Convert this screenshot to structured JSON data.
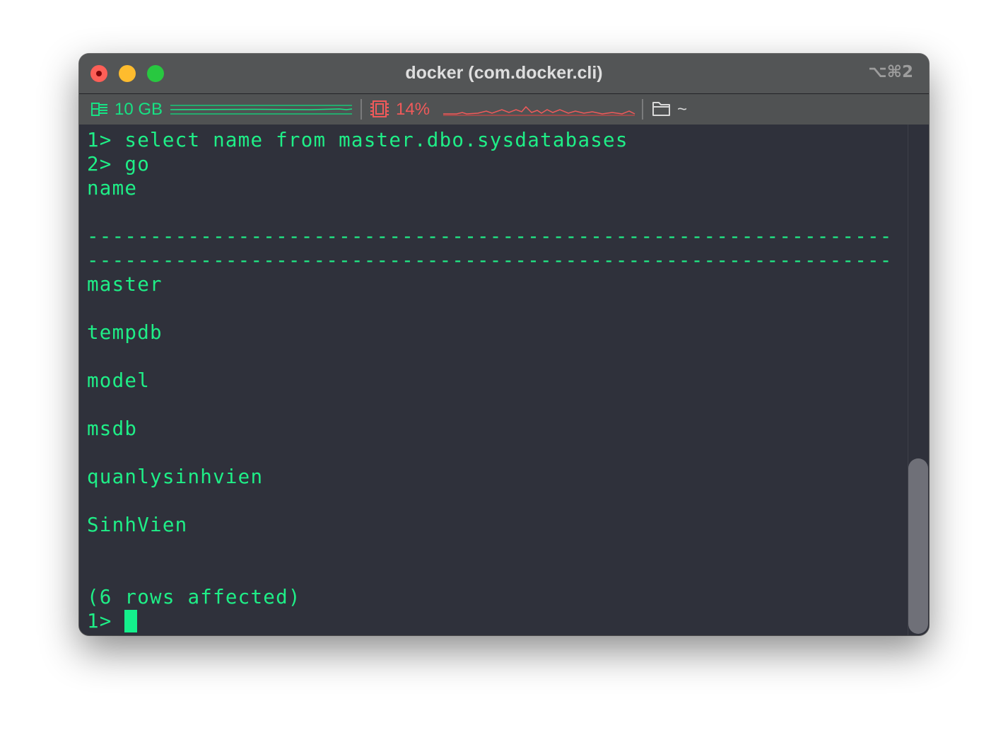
{
  "window": {
    "title": "docker (com.docker.cli)",
    "shortcut": "⌥⌘2"
  },
  "statusbar": {
    "memory": {
      "value": "10 GB",
      "color": "#17e284",
      "icon": "memory-icon"
    },
    "cpu": {
      "value": "14%",
      "color": "#f05a5a",
      "icon": "cpu-icon"
    },
    "path": {
      "value": "~",
      "icon": "folder-icon"
    }
  },
  "terminal": {
    "lines": [
      "1> select name from master.dbo.sysdatabases",
      "2> go",
      "name",
      "",
      "----------------------------------------------------------------",
      "----------------------------------------------------------------",
      "master",
      "",
      "tempdb",
      "",
      "model",
      "",
      "msdb",
      "",
      "quanlysinhvien",
      "",
      "SinhVien",
      "",
      "",
      "(6 rows affected)",
      "1> "
    ],
    "text_color": "#1fee87",
    "background": "#2f313b"
  }
}
